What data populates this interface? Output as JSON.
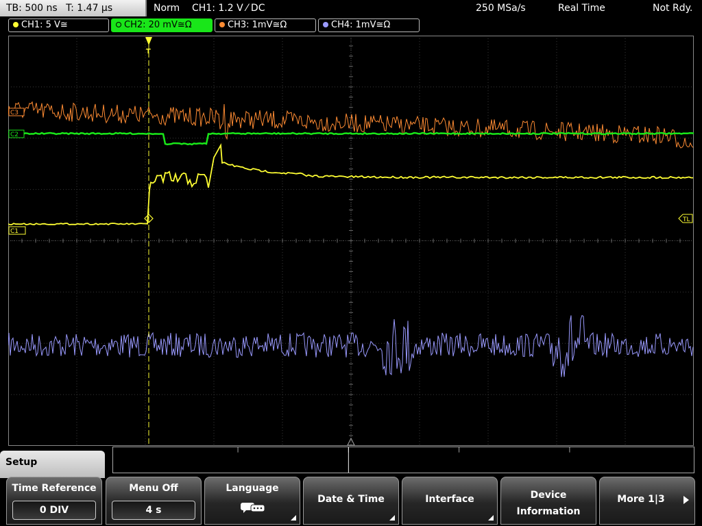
{
  "topbar": {
    "timebase": "TB: 500 ns",
    "trigger_time": "T: 1.47 µs",
    "mode": "Norm",
    "trigger_info": "CH1: 1.2 V ⁄ DC",
    "sample_rate": "250 MSa/s",
    "acq_mode": "Real Time",
    "status": "Not Rdy."
  },
  "channels": [
    {
      "label": "CH1: 5 V≅",
      "color": "#ffff33",
      "active": false
    },
    {
      "label": "CH2: 20 mV≅Ω",
      "color": "#19e619",
      "active": true
    },
    {
      "label": "CH3: 1mV≅Ω",
      "color": "#ff8c33",
      "active": false
    },
    {
      "label": "CH4: 1mV≅Ω",
      "color": "#9a9aff",
      "active": false
    }
  ],
  "markers": {
    "c1": "C1",
    "c2": "C2",
    "c3": "C3",
    "trig_level": "TL",
    "trigger_pos": "T"
  },
  "colors": {
    "ch1": "#ffff33",
    "ch2": "#19e619",
    "ch3": "#ff8c33",
    "ch4": "#9a9aff",
    "grid": "#3a3a3a",
    "trigger": "#ffff33"
  },
  "menu": {
    "title": "Setup",
    "keys": [
      {
        "label": "Time Reference",
        "value": "0 DIV"
      },
      {
        "label": "Menu Off",
        "value": "4 s"
      },
      {
        "label": "Language",
        "icon": "speech-bubble-icon"
      },
      {
        "label": "Date & Time"
      },
      {
        "label": "Interface"
      },
      {
        "label": "Device",
        "label2": "Information"
      },
      {
        "label": "More 1|3"
      }
    ]
  }
}
